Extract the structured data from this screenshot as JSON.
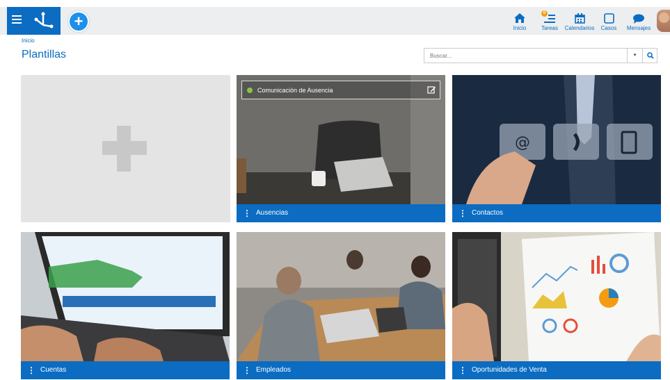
{
  "header": {
    "nav": [
      {
        "label": "Inicio",
        "icon": "home-icon"
      },
      {
        "label": "Tareas",
        "icon": "tasks-icon",
        "badge": "0"
      },
      {
        "label": "Calendarios",
        "icon": "calendar-icon"
      },
      {
        "label": "Casos",
        "icon": "cases-icon"
      },
      {
        "label": "Mensajes",
        "icon": "chat-icon"
      }
    ],
    "add_label": "+"
  },
  "breadcrumb": "Inicio",
  "page_title": "Plantillas",
  "search": {
    "placeholder": "Buscar...",
    "dropdown": "▾"
  },
  "cards": [
    {
      "title": "Ausencias",
      "overlay": "Comunicación de Ausencia"
    },
    {
      "title": "Contactos"
    },
    {
      "title": "Cuentas"
    },
    {
      "title": "Empleados"
    },
    {
      "title": "Oportunidades de Venta"
    }
  ],
  "kebab": "⋮",
  "colors": {
    "brand": "#0b6cc2",
    "topbar": "#eceeef",
    "status_dot": "#8bc34a",
    "badge": "#f39c12"
  }
}
